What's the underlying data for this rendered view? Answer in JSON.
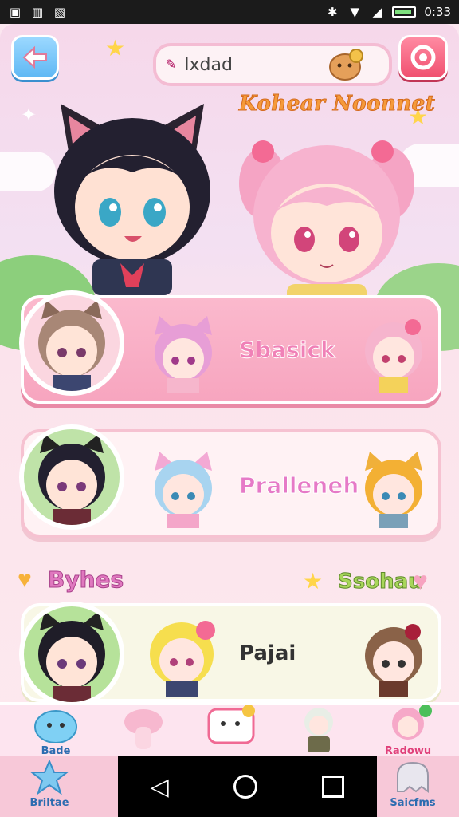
{
  "status_bar": {
    "time": "0:33"
  },
  "search": {
    "value": "lxdad"
  },
  "header": {
    "title": "Kohear Noonnet"
  },
  "cards": [
    {
      "label": "Sbasick",
      "color": "#f081b7"
    },
    {
      "label": "Pralleneh",
      "color": "#e67ac7"
    },
    {
      "label": "Pajai",
      "color": "#333333"
    }
  ],
  "sections": {
    "left": "Byhes",
    "right": "Ssohau"
  },
  "bottom_tabs": [
    {
      "label": "Bade",
      "icon": "blob-icon"
    },
    {
      "label": "",
      "icon": "mushroom-icon"
    },
    {
      "label": "",
      "icon": "chat-bubble-icon"
    },
    {
      "label": "",
      "icon": "character-icon"
    },
    {
      "label": "Radowu",
      "icon": "pink-girl-icon"
    }
  ],
  "nav": {
    "left_label": "Briltae",
    "right_label": "Saicfms"
  },
  "colors": {
    "accent_pink": "#f081b7",
    "accent_blue": "#5fb8f4",
    "accent_red": "#f0506f"
  }
}
